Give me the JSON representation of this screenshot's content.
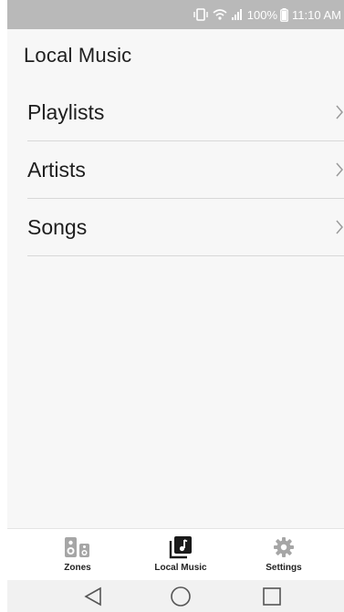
{
  "status_bar": {
    "battery": "100%",
    "time": "11:10 AM"
  },
  "header": {
    "title": "Local Music"
  },
  "list": {
    "items": [
      {
        "label": "Playlists"
      },
      {
        "label": "Artists"
      },
      {
        "label": "Songs"
      }
    ]
  },
  "bottom_nav": {
    "items": [
      {
        "label": "Zones",
        "icon": "speaker-icon"
      },
      {
        "label": "Local Music",
        "icon": "music-library-icon",
        "active": true
      },
      {
        "label": "Settings",
        "icon": "gear-icon"
      }
    ]
  },
  "system_nav": {
    "icons": [
      "back-icon",
      "home-icon",
      "recents-icon"
    ]
  },
  "colors": {
    "status_bar_bg": "#b9b9b9",
    "divider": "#d8d8d8",
    "text": "#1e1e1e",
    "chevron": "#9a9a9a"
  }
}
